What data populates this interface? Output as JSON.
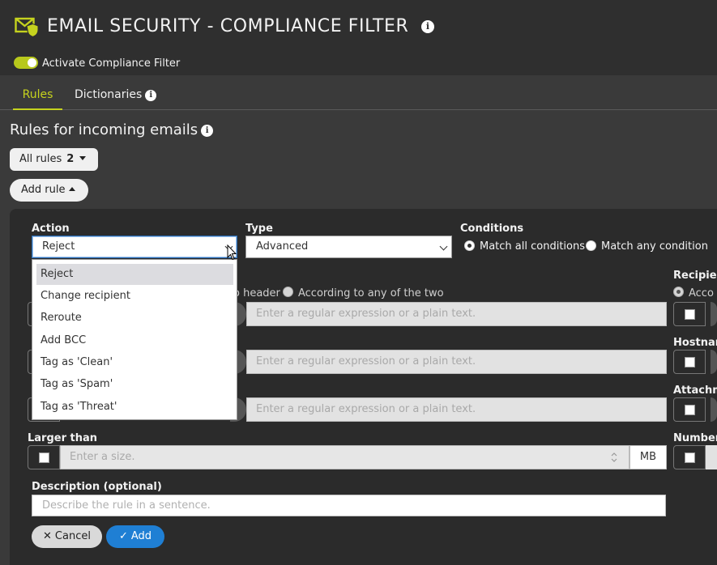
{
  "app": {
    "title": "EMAIL SECURITY - COMPLIANCE FILTER",
    "accent_color": "#c5d21e",
    "icon": "shield-envelope-icon"
  },
  "activate": {
    "label": "Activate Compliance Filter",
    "enabled": true
  },
  "tabs": [
    {
      "label": "Rules",
      "active": true
    },
    {
      "label": "Dictionaries",
      "active": false
    }
  ],
  "section": {
    "title": "Rules for incoming emails"
  },
  "all_rules": {
    "label": "All rules",
    "count": "2"
  },
  "add_rule": {
    "label": "Add rule"
  },
  "form": {
    "action": {
      "label": "Action",
      "value": "Reject",
      "options": [
        "Reject",
        "Change recipient",
        "Reroute",
        "Add BCC",
        "Tag as 'Clean'",
        "Tag as 'Spam'",
        "Tag as 'Threat'"
      ]
    },
    "type": {
      "label": "Type",
      "value": "Advanced"
    },
    "conditions": {
      "label": "Conditions",
      "match_all": "Match all conditions",
      "match_any": "Match any condition",
      "selected": "match_all"
    },
    "sender_radios": {
      "header": "o header",
      "any": "According to any of the two"
    },
    "placeholder_regex": "Enter a regular expression or a plain text.",
    "right_labels": {
      "recipient": "Recipien",
      "recipient_radio": "Acco",
      "hostname": "Hostnam",
      "attachment": "Attachm",
      "number": "Number"
    },
    "larger_than": {
      "label": "Larger than",
      "placeholder": "Enter a size.",
      "unit": "MB"
    },
    "description": {
      "label": "Description (optional)",
      "placeholder": "Describe the rule in a sentence."
    },
    "cancel_label": "Cancel",
    "add_label": "Add"
  }
}
